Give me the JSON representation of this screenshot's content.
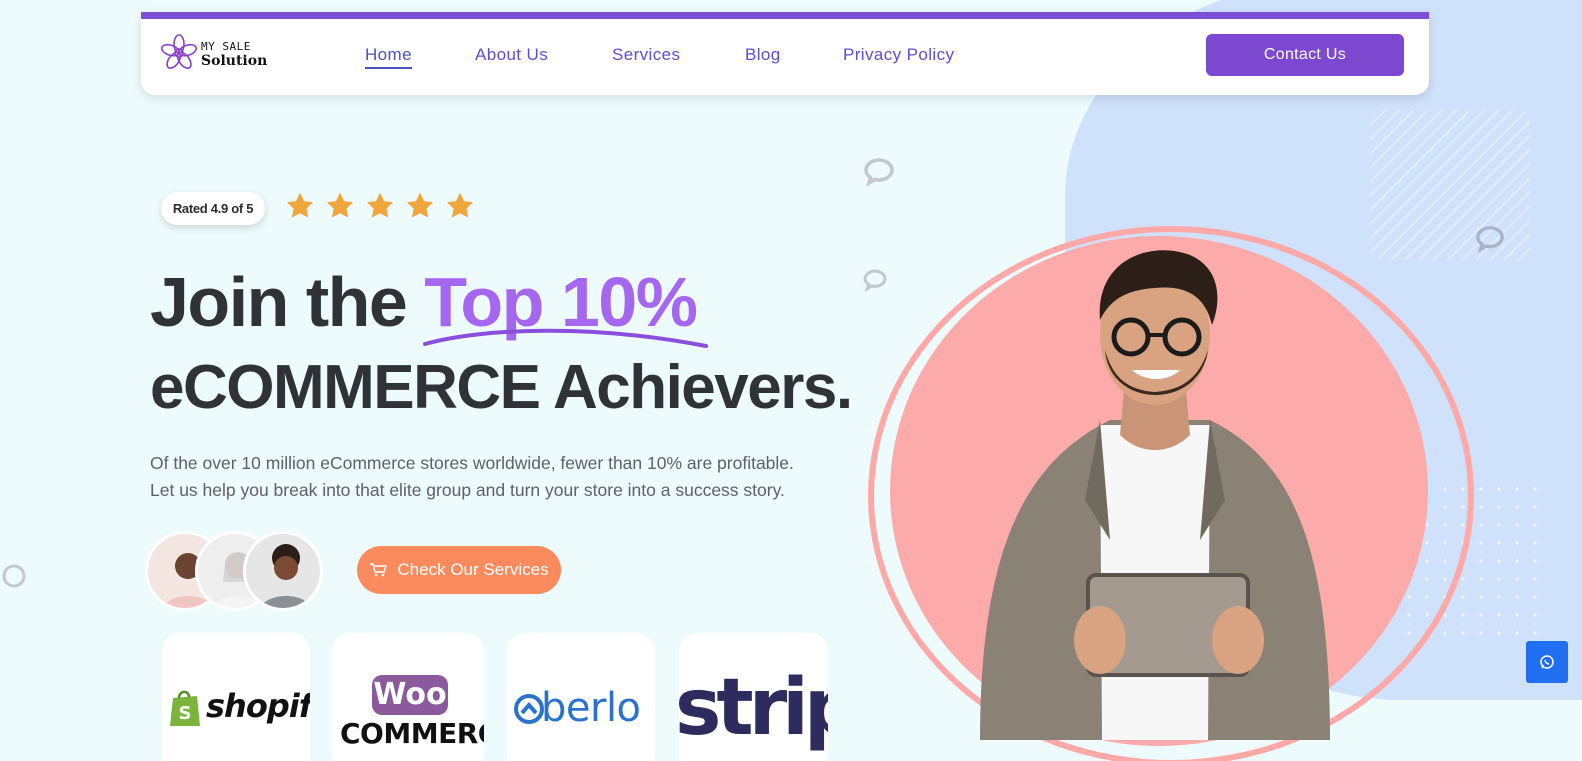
{
  "brand": {
    "logo_top": "MY SALE",
    "logo_bottom": "Solution",
    "accent_color": "#7b48cf",
    "highlight_color": "#a566f0",
    "cta_color": "#fb8a5c"
  },
  "nav": {
    "links": [
      {
        "label": "Home",
        "active": true
      },
      {
        "label": "About Us",
        "active": false
      },
      {
        "label": "Services",
        "active": false
      },
      {
        "label": "Blog",
        "active": false
      },
      {
        "label": "Privacy Policy",
        "active": false
      }
    ],
    "contact_label": "Contact Us"
  },
  "hero": {
    "rating_text": "Rated 4.9 of 5",
    "stars": 5,
    "headline_prefix": "Join the ",
    "headline_accent": "Top 10%",
    "headline_line2": "eCOMMERCE Achievers.",
    "lead_line1": "Of the over 10 million eCommerce stores worldwide, fewer than 10% are profitable.",
    "lead_line2": "Let us help you break into that elite group and turn your store into a success story.",
    "cta_label": "Check Our Services",
    "cta_icon": "cart-icon"
  },
  "brands": [
    {
      "name": "shopify",
      "display": "shopify"
    },
    {
      "name": "woocommerce",
      "display_top": "Woo",
      "display_bottom": "COMMERCE"
    },
    {
      "name": "oberlo",
      "display": "berlo"
    },
    {
      "name": "stripe",
      "display": "stripe"
    }
  ],
  "floating": {
    "whatsapp_icon": "whatsapp-icon"
  }
}
